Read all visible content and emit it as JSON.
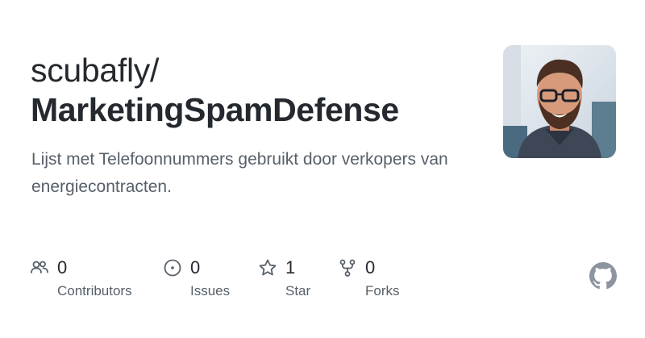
{
  "repo": {
    "owner": "scubafly/",
    "name": "MarketingSpamDefense",
    "description": "Lijst met Telefoonnummers gebruikt door verkopers van energiecontracten."
  },
  "stats": [
    {
      "icon": "people-icon",
      "count": "0",
      "label": "Contributors"
    },
    {
      "icon": "issue-icon",
      "count": "0",
      "label": "Issues"
    },
    {
      "icon": "star-icon",
      "count": "1",
      "label": "Star"
    },
    {
      "icon": "fork-icon",
      "count": "0",
      "label": "Forks"
    }
  ],
  "colors": {
    "text": "#24292f",
    "muted": "#57606a",
    "logo": "#8c959f"
  }
}
